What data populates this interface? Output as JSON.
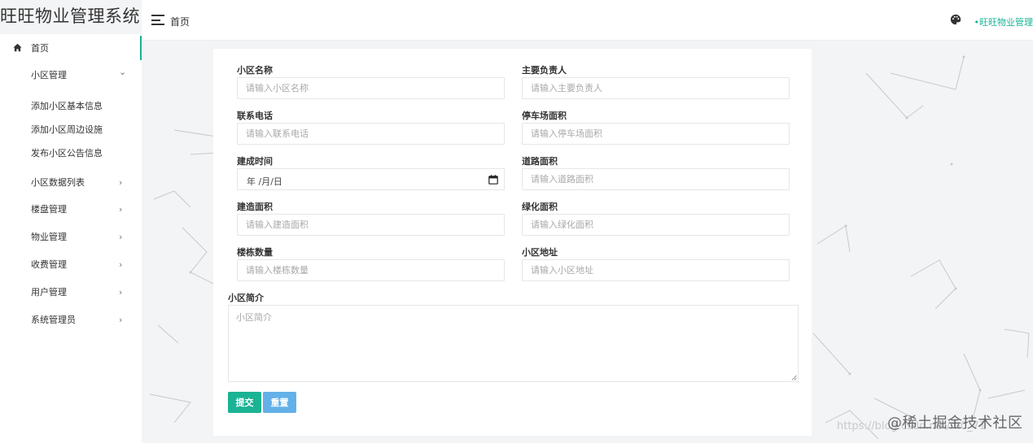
{
  "app": {
    "title": "旺旺物业管理系统"
  },
  "topbar": {
    "breadcrumb": "首页",
    "brand": "•旺旺物业管理"
  },
  "sidebar": {
    "home": "首页",
    "community": {
      "label": "小区管理",
      "arrow": "⌄",
      "children": [
        "添加小区基本信息",
        "添加小区周边设施",
        "发布小区公告信息"
      ]
    },
    "items": [
      {
        "label": "小区数据列表",
        "arrow": "›"
      },
      {
        "label": "楼盘管理",
        "arrow": "›"
      },
      {
        "label": "物业管理",
        "arrow": "›"
      },
      {
        "label": "收费管理",
        "arrow": "›"
      },
      {
        "label": "用户管理",
        "arrow": "›"
      },
      {
        "label": "系统管理员",
        "arrow": "›"
      }
    ]
  },
  "form": {
    "fields": [
      {
        "label": "小区名称",
        "placeholder": "请输入小区名称"
      },
      {
        "label": "主要负责人",
        "placeholder": "请输入主要负责人"
      },
      {
        "label": "联系电话",
        "placeholder": "请输入联系电话"
      },
      {
        "label": "停车场面积",
        "placeholder": "请输入停车场面积"
      },
      {
        "label": "建成时间",
        "placeholder": "年 /月/日"
      },
      {
        "label": "道路面积",
        "placeholder": "请输入道路面积"
      },
      {
        "label": "建造面积",
        "placeholder": "请输入建造面积"
      },
      {
        "label": "绿化面积",
        "placeholder": "请输入绿化面积"
      },
      {
        "label": "楼栋数量",
        "placeholder": "请输入楼栋数量"
      },
      {
        "label": "小区地址",
        "placeholder": "请输入小区地址"
      }
    ],
    "intro": {
      "label": "小区简介",
      "placeholder": "小区简介"
    },
    "submit_label": "提交",
    "reset_label": "重置"
  },
  "watermark": {
    "url": "https://blog.csdn.net/m0_71",
    "badge": "@稀土掘金技术社区"
  },
  "colors": {
    "accent": "#1ab394",
    "reset": "#4aa3e6"
  }
}
